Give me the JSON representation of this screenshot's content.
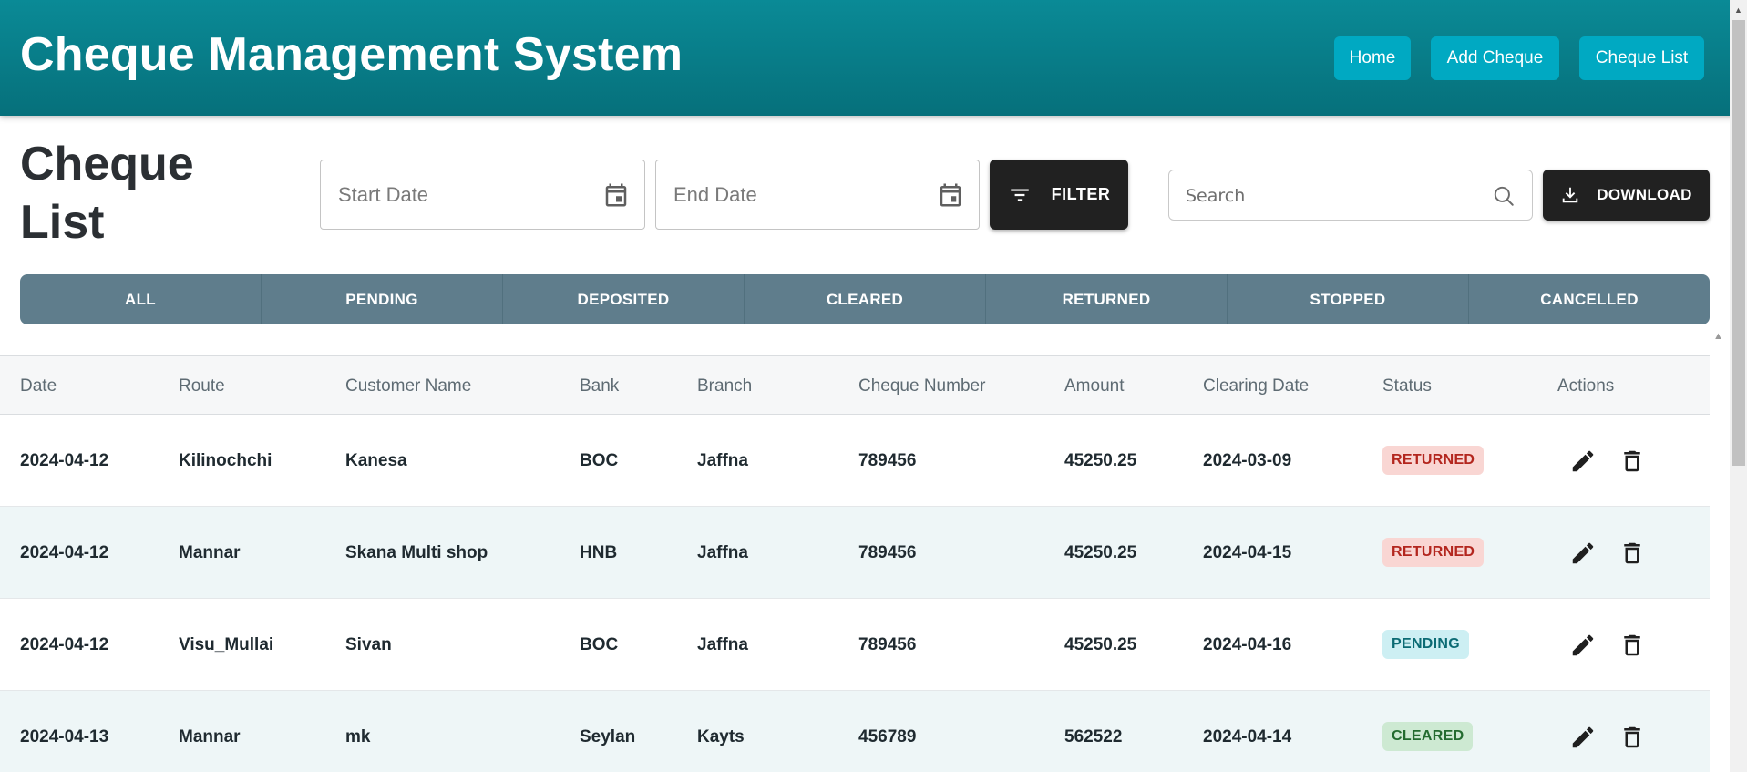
{
  "header": {
    "title": "Cheque Management System",
    "nav": [
      {
        "label": "Home"
      },
      {
        "label": "Add Cheque"
      },
      {
        "label": "Cheque List"
      }
    ]
  },
  "page": {
    "title": "Cheque List"
  },
  "filters": {
    "start_date_placeholder": "Start Date",
    "end_date_placeholder": "End Date",
    "filter_label": "FILTER",
    "search_placeholder": "Search",
    "download_label": "DOWNLOAD"
  },
  "status_tabs": [
    {
      "label": "ALL"
    },
    {
      "label": "PENDING"
    },
    {
      "label": "DEPOSITED"
    },
    {
      "label": "CLEARED"
    },
    {
      "label": "RETURNED"
    },
    {
      "label": "STOPPED"
    },
    {
      "label": "CANCELLED"
    }
  ],
  "table": {
    "columns": [
      "Date",
      "Route",
      "Customer Name",
      "Bank",
      "Branch",
      "Cheque Number",
      "Amount",
      "Clearing Date",
      "Status",
      "Actions"
    ],
    "rows": [
      {
        "date": "2024-04-12",
        "route": "Kilinochchi",
        "customer": "Kanesa",
        "bank": "BOC",
        "branch": "Jaffna",
        "cheque_number": "789456",
        "amount": "45250.25",
        "clearing_date": "2024-03-09",
        "status": "RETURNED"
      },
      {
        "date": "2024-04-12",
        "route": "Mannar",
        "customer": "Skana Multi shop",
        "bank": "HNB",
        "branch": "Jaffna",
        "cheque_number": "789456",
        "amount": "45250.25",
        "clearing_date": "2024-04-15",
        "status": "RETURNED"
      },
      {
        "date": "2024-04-12",
        "route": "Visu_Mullai",
        "customer": "Sivan",
        "bank": "BOC",
        "branch": "Jaffna",
        "cheque_number": "789456",
        "amount": "45250.25",
        "clearing_date": "2024-04-16",
        "status": "PENDING"
      },
      {
        "date": "2024-04-13",
        "route": "Mannar",
        "customer": "mk",
        "bank": "Seylan",
        "branch": "Kayts",
        "cheque_number": "456789",
        "amount": "562522",
        "clearing_date": "2024-04-14",
        "status": "CLEARED"
      }
    ]
  },
  "colors": {
    "header_gradient_top": "#0a8a96",
    "header_gradient_bottom": "#06707b",
    "nav_button": "#00a9c2",
    "tab_bar": "#5f7d8c",
    "dark_button": "#212121",
    "status_returned": "#b3261e",
    "status_pending": "#0b6b74",
    "status_cleared": "#236b2f"
  },
  "icons": {
    "calendar": "calendar-icon",
    "filter": "filter-icon",
    "search": "search-icon",
    "download": "download-icon",
    "edit": "pencil-icon",
    "delete": "trash-icon"
  }
}
